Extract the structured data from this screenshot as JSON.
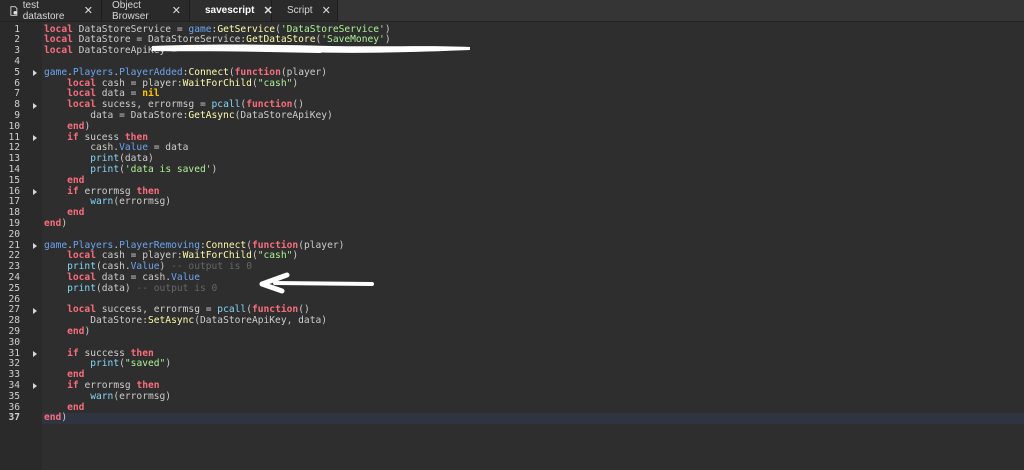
{
  "tabs": [
    {
      "label": "test datastore",
      "icon": "script-doc-icon",
      "active": false
    },
    {
      "label": "Object Browser",
      "icon": "",
      "active": false
    },
    {
      "label": "savescript",
      "icon": "script-icon",
      "active": true
    },
    {
      "label": "Script",
      "icon": "script-icon",
      "active": false
    }
  ],
  "close_glyph": "✕",
  "current_line": 37,
  "fold_lines": [
    5,
    8,
    11,
    16,
    21,
    27,
    31,
    34
  ],
  "lines": [
    [
      [
        "k",
        "local"
      ],
      [
        "t",
        " DataStoreService = "
      ],
      [
        "b",
        "game"
      ],
      [
        "t",
        ":"
      ],
      [
        "f",
        "GetService"
      ],
      [
        "t",
        "("
      ],
      [
        "s",
        "'DataStoreService'"
      ],
      [
        "t",
        ")"
      ]
    ],
    [
      [
        "k",
        "local"
      ],
      [
        "t",
        " DataStore = DataStoreService:"
      ],
      [
        "f",
        "GetDataStore"
      ],
      [
        "t",
        "("
      ],
      [
        "s",
        "'SaveMoney'"
      ],
      [
        "t",
        ")"
      ]
    ],
    [
      [
        "k",
        "local"
      ],
      [
        "t",
        " DataStoreApiKey = "
      ]
    ],
    [],
    [
      [
        "b",
        "game"
      ],
      [
        "t",
        "."
      ],
      [
        "b",
        "Players"
      ],
      [
        "t",
        "."
      ],
      [
        "b",
        "PlayerAdded"
      ],
      [
        "t",
        ":"
      ],
      [
        "f",
        "Connect"
      ],
      [
        "t",
        "("
      ],
      [
        "k",
        "function"
      ],
      [
        "t",
        "(player)"
      ]
    ],
    [
      [
        "t",
        "    "
      ],
      [
        "k",
        "local"
      ],
      [
        "t",
        " cash = player:"
      ],
      [
        "f",
        "WaitForChild"
      ],
      [
        "t",
        "("
      ],
      [
        "s",
        "\"cash\""
      ],
      [
        "t",
        ")"
      ]
    ],
    [
      [
        "t",
        "    "
      ],
      [
        "k",
        "local"
      ],
      [
        "t",
        " data = "
      ],
      [
        "n",
        "nil"
      ]
    ],
    [
      [
        "t",
        "    "
      ],
      [
        "k",
        "local"
      ],
      [
        "t",
        " sucess, errormsg = "
      ],
      [
        "p",
        "pcall"
      ],
      [
        "t",
        "("
      ],
      [
        "k",
        "function"
      ],
      [
        "t",
        "()"
      ]
    ],
    [
      [
        "t",
        "        data = DataStore:"
      ],
      [
        "f",
        "GetAsync"
      ],
      [
        "t",
        "(DataStoreApiKey)"
      ]
    ],
    [
      [
        "t",
        "    "
      ],
      [
        "k",
        "end"
      ],
      [
        "t",
        ")"
      ]
    ],
    [
      [
        "t",
        "    "
      ],
      [
        "k",
        "if"
      ],
      [
        "t",
        " sucess "
      ],
      [
        "k",
        "then"
      ]
    ],
    [
      [
        "t",
        "        cash."
      ],
      [
        "b",
        "Value"
      ],
      [
        "t",
        " = data"
      ]
    ],
    [
      [
        "t",
        "        "
      ],
      [
        "p",
        "print"
      ],
      [
        "t",
        "(data)"
      ]
    ],
    [
      [
        "t",
        "        "
      ],
      [
        "p",
        "print"
      ],
      [
        "t",
        "("
      ],
      [
        "s",
        "'data is saved'"
      ],
      [
        "t",
        ")"
      ]
    ],
    [
      [
        "t",
        "    "
      ],
      [
        "k",
        "end"
      ]
    ],
    [
      [
        "t",
        "    "
      ],
      [
        "k",
        "if"
      ],
      [
        "t",
        " errormsg "
      ],
      [
        "k",
        "then"
      ]
    ],
    [
      [
        "t",
        "        "
      ],
      [
        "p",
        "warn"
      ],
      [
        "t",
        "(errormsg)"
      ]
    ],
    [
      [
        "t",
        "    "
      ],
      [
        "k",
        "end"
      ]
    ],
    [
      [
        "k",
        "end"
      ],
      [
        "t",
        ")"
      ]
    ],
    [],
    [
      [
        "b",
        "game"
      ],
      [
        "t",
        "."
      ],
      [
        "b",
        "Players"
      ],
      [
        "t",
        "."
      ],
      [
        "b",
        "PlayerRemoving"
      ],
      [
        "t",
        ":"
      ],
      [
        "f",
        "Connect"
      ],
      [
        "t",
        "("
      ],
      [
        "k",
        "function"
      ],
      [
        "t",
        "(player)"
      ]
    ],
    [
      [
        "t",
        "    "
      ],
      [
        "k",
        "local"
      ],
      [
        "t",
        " cash = player:"
      ],
      [
        "f",
        "WaitForChild"
      ],
      [
        "t",
        "("
      ],
      [
        "s",
        "\"cash\""
      ],
      [
        "t",
        ")"
      ]
    ],
    [
      [
        "t",
        "    "
      ],
      [
        "p",
        "print"
      ],
      [
        "t",
        "(cash."
      ],
      [
        "b",
        "Value"
      ],
      [
        "t",
        ") "
      ],
      [
        "c",
        "-- output is 0"
      ]
    ],
    [
      [
        "t",
        "    "
      ],
      [
        "k",
        "local"
      ],
      [
        "t",
        " data = cash."
      ],
      [
        "b",
        "Value"
      ]
    ],
    [
      [
        "t",
        "    "
      ],
      [
        "p",
        "print"
      ],
      [
        "t",
        "(data) "
      ],
      [
        "c",
        "-- output is 0"
      ]
    ],
    [],
    [
      [
        "t",
        "    "
      ],
      [
        "k",
        "local"
      ],
      [
        "t",
        " success, errormsg = "
      ],
      [
        "p",
        "pcall"
      ],
      [
        "t",
        "("
      ],
      [
        "k",
        "function"
      ],
      [
        "t",
        "()"
      ]
    ],
    [
      [
        "t",
        "        DataStore:"
      ],
      [
        "f",
        "SetAsync"
      ],
      [
        "t",
        "(DataStoreApiKey, data)"
      ]
    ],
    [
      [
        "t",
        "    "
      ],
      [
        "k",
        "end"
      ],
      [
        "t",
        ")"
      ]
    ],
    [],
    [
      [
        "t",
        "    "
      ],
      [
        "k",
        "if"
      ],
      [
        "t",
        " success "
      ],
      [
        "k",
        "then"
      ]
    ],
    [
      [
        "t",
        "        "
      ],
      [
        "p",
        "print"
      ],
      [
        "t",
        "("
      ],
      [
        "s",
        "\"saved\""
      ],
      [
        "t",
        ")"
      ]
    ],
    [
      [
        "t",
        "    "
      ],
      [
        "k",
        "end"
      ]
    ],
    [
      [
        "t",
        "    "
      ],
      [
        "k",
        "if"
      ],
      [
        "t",
        " errormsg "
      ],
      [
        "k",
        "then"
      ]
    ],
    [
      [
        "t",
        "        "
      ],
      [
        "p",
        "warn"
      ],
      [
        "t",
        "(errormsg)"
      ]
    ],
    [
      [
        "t",
        "    "
      ],
      [
        "k",
        "end"
      ]
    ],
    [
      [
        "k",
        "end"
      ],
      [
        "t",
        ")"
      ]
    ]
  ]
}
